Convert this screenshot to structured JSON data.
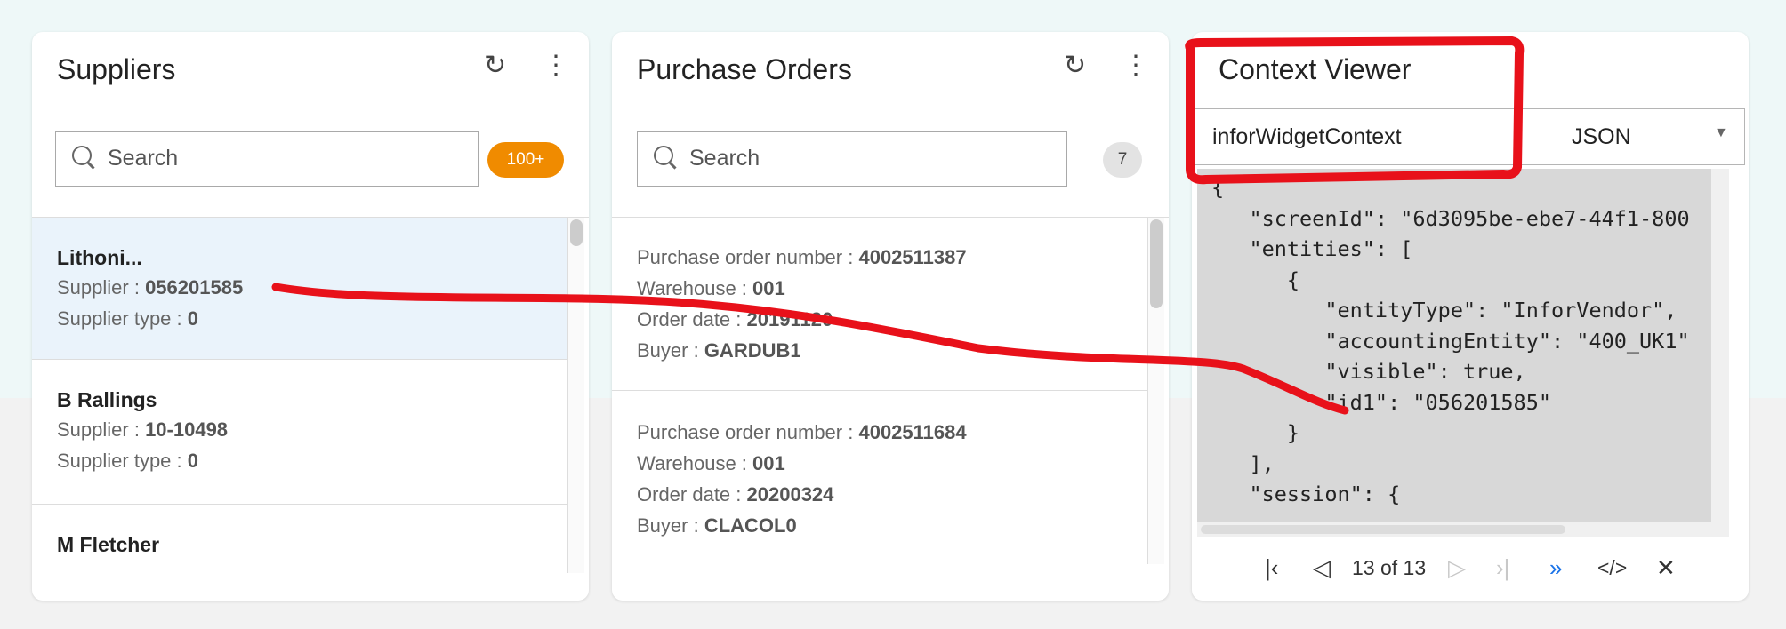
{
  "suppliers": {
    "title": "Suppliers",
    "refresh_icon": "refresh-icon",
    "more_icon": "more-vertical-icon",
    "search_placeholder": "Search",
    "count_badge": "100+",
    "badge_color": "#f08b00",
    "items": [
      {
        "name": "Lithoni...",
        "supplier_label": "Supplier : ",
        "supplier": "056201585",
        "type_label": "Supplier type : ",
        "type": "0"
      },
      {
        "name": "B Rallings",
        "supplier_label": "Supplier : ",
        "supplier": "10-10498",
        "type_label": "Supplier type : ",
        "type": "0"
      },
      {
        "name": "M Fletcher"
      }
    ]
  },
  "purchase_orders": {
    "title": "Purchase Orders",
    "refresh_icon": "refresh-icon",
    "more_icon": "more-vertical-icon",
    "search_placeholder": "Search",
    "count_badge": "7",
    "items": [
      {
        "po_label": "Purchase order number : ",
        "po": "4002511387",
        "wh_label": "Warehouse : ",
        "wh": "001",
        "date_label": "Order date : ",
        "date": "20191120",
        "buyer_label": "Buyer : ",
        "buyer": "GARDUB1"
      },
      {
        "po_label": "Purchase order number : ",
        "po": "4002511684",
        "wh_label": "Warehouse : ",
        "wh": "001",
        "date_label": "Order date : ",
        "date": "20200324",
        "buyer_label": "Buyer : ",
        "buyer": "CLACOL0"
      }
    ]
  },
  "context_viewer": {
    "title": "Context Viewer",
    "context_select": "inforWidgetContext",
    "format_select": "JSON",
    "json_text": "{\n   \"screenId\": \"6d3095be-ebe7-44f1-800\n   \"entities\": [\n      {\n         \"entityType\": \"InforVendor\",\n         \"accountingEntity\": \"400_UK1\"\n         \"visible\": true,\n         \"id1\": \"056201585\"\n      }\n   ],\n   \"session\": {",
    "pager": {
      "first_icon": "first-page-icon",
      "prev_icon": "previous-icon",
      "position": "13 of 13",
      "next_icon": "next-icon",
      "last_icon": "last-page-icon",
      "forward_icon": "double-chevron-right-icon",
      "code_icon": "code-icon",
      "close_icon": "close-icon"
    }
  },
  "annotation_color": "#e8111a"
}
